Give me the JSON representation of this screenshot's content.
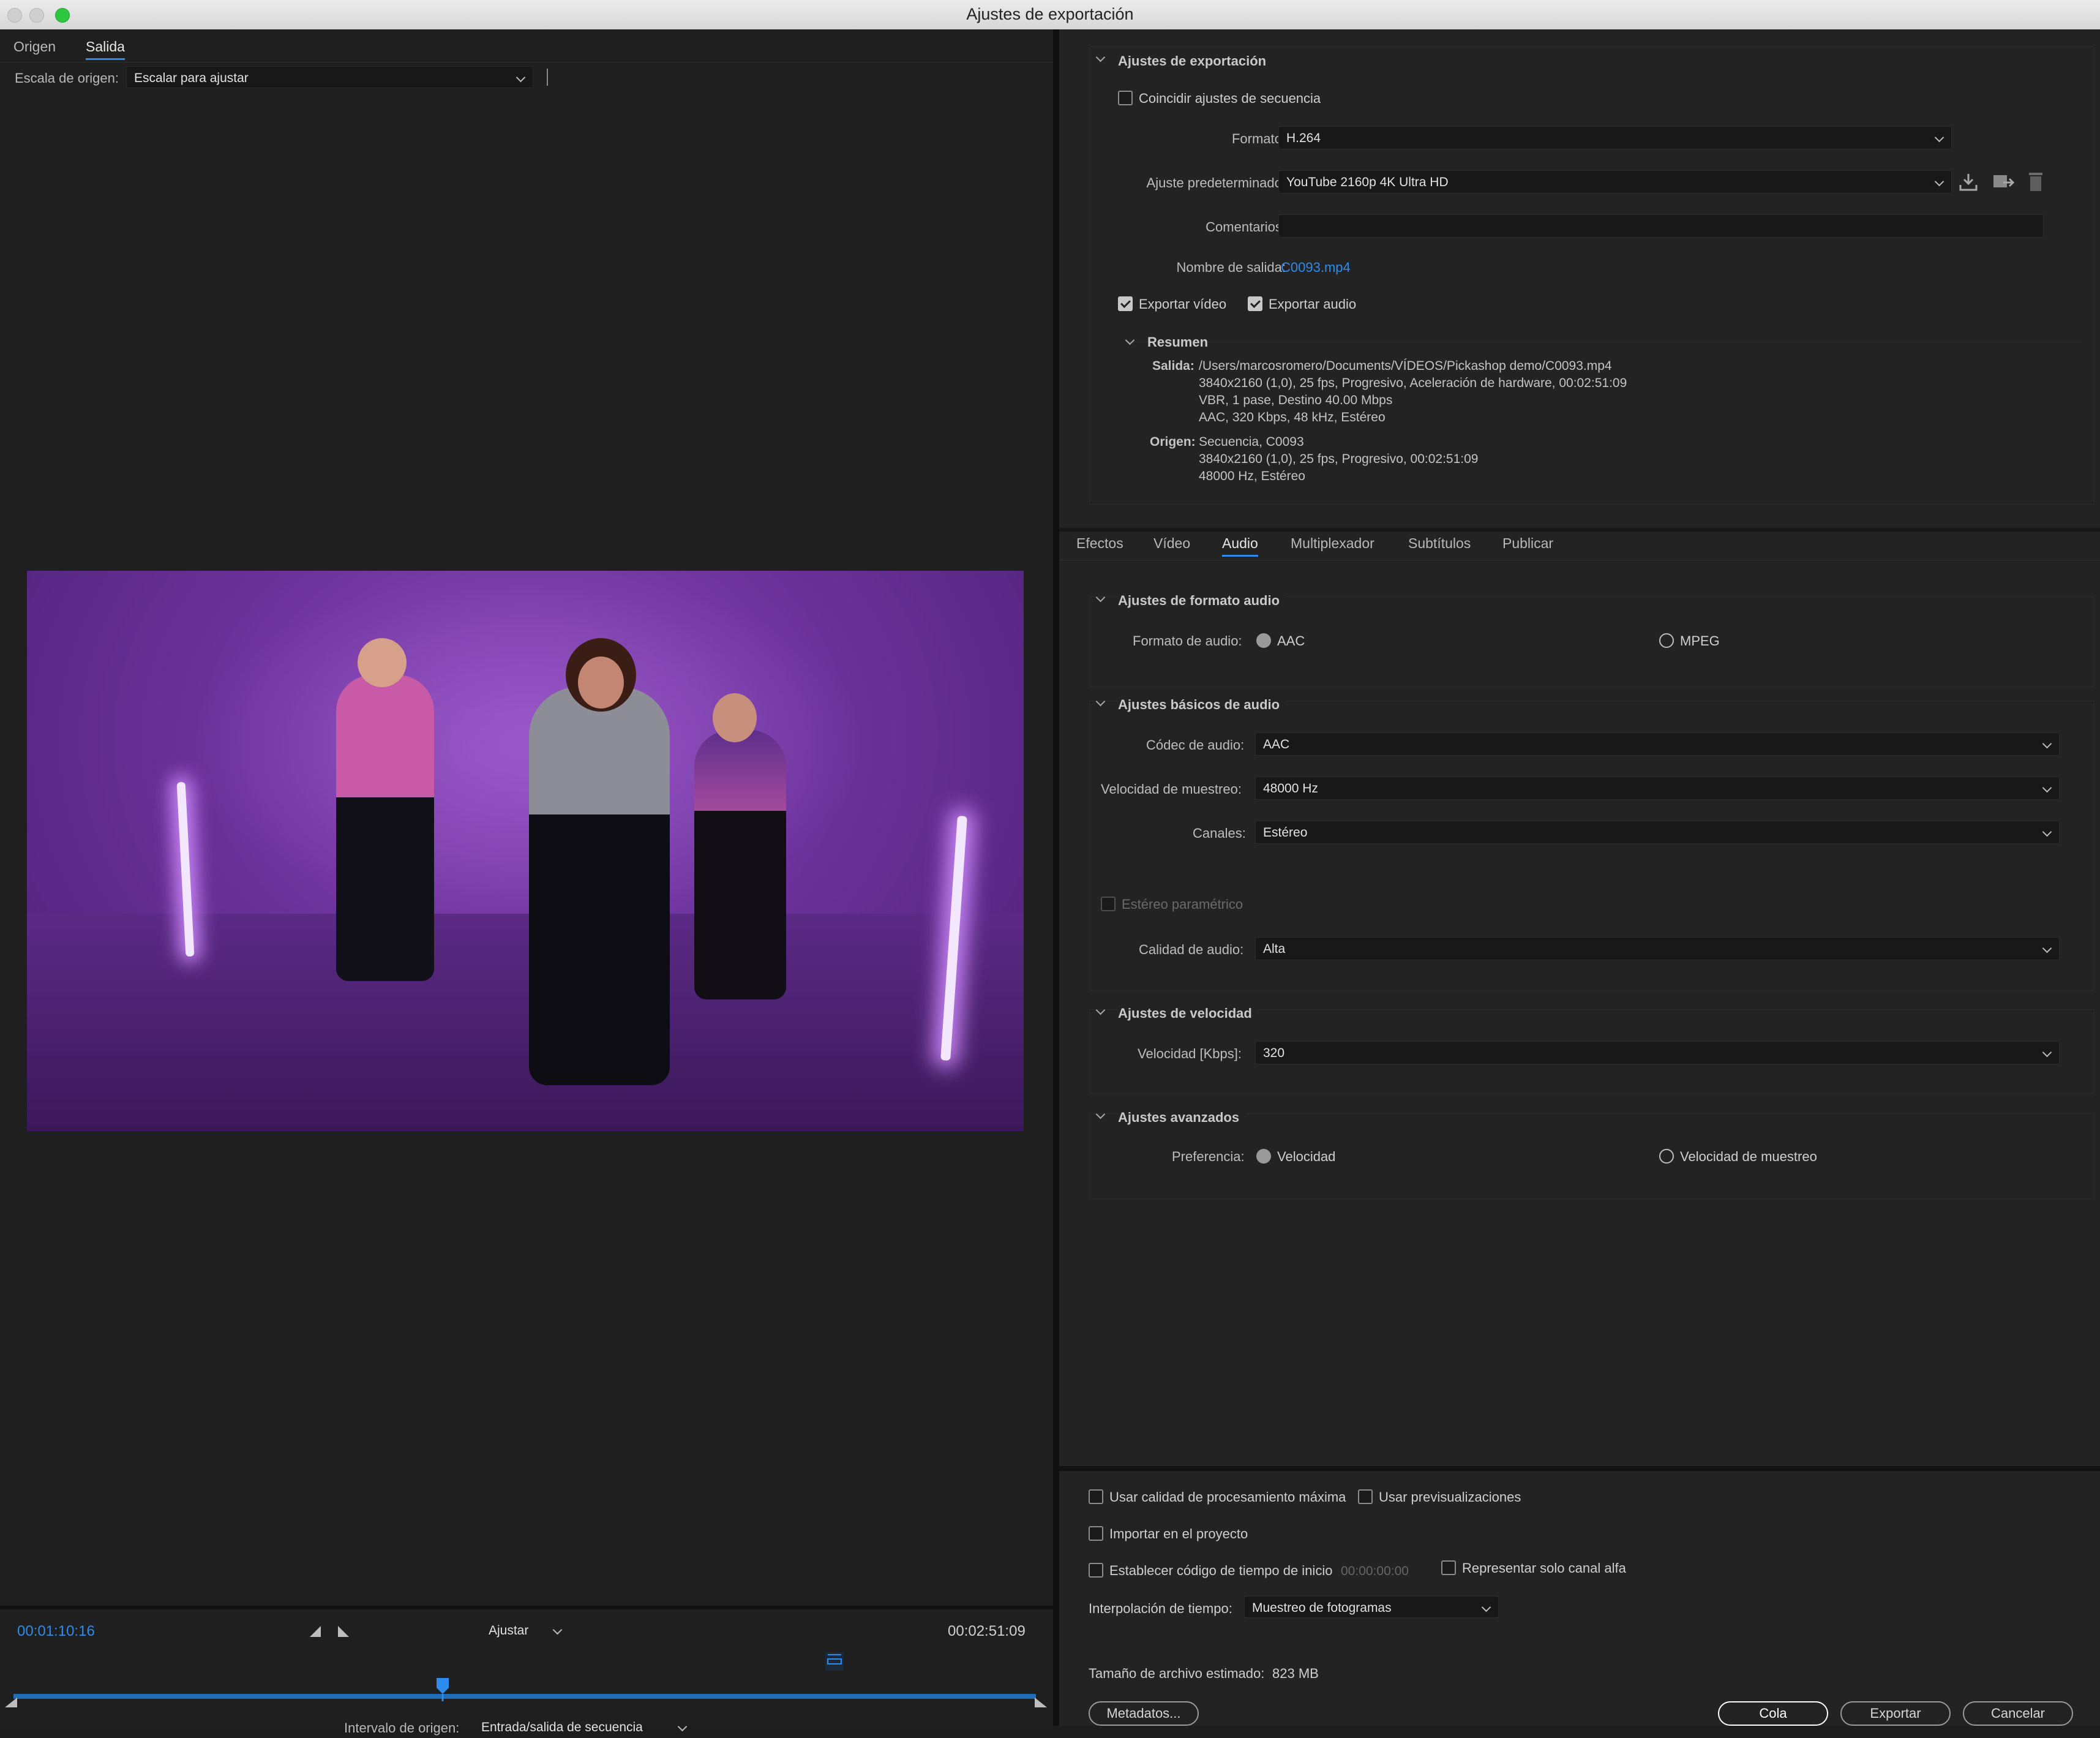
{
  "window": {
    "title": "Ajustes de exportación"
  },
  "left": {
    "tabs": [
      {
        "label": "Origen"
      },
      {
        "label": "Salida"
      }
    ],
    "source_scale": {
      "label": "Escala de origen:",
      "value": "Escalar para ajustar"
    },
    "timeline": {
      "current_time": "00:01:10:16",
      "zoom": "Ajustar",
      "duration": "00:02:51:09",
      "playhead_position": 0.42,
      "source_range_label": "Intervalo de origen:",
      "source_range_value": "Entrada/salida de secuencia"
    }
  },
  "export_settings": {
    "heading": "Ajustes de exportación",
    "match_sequence": "Coincidir ajustes de secuencia",
    "format_label": "Formato:",
    "format_value": "H.264",
    "preset_label": "Ajuste predeterminado:",
    "preset_value": "YouTube 2160p 4K Ultra HD",
    "comments_label": "Comentarios:",
    "output_name_label": "Nombre de salida:",
    "output_name_value": "C0093.mp4",
    "export_video": "Exportar vídeo",
    "export_audio": "Exportar audio",
    "summary": {
      "heading": "Resumen",
      "output_label": "Salida:",
      "output_lines": [
        "/Users/marcosromero/Documents/VÍDEOS/Pickashop demo/C0093.mp4",
        "3840x2160 (1,0), 25 fps, Progresivo,  Aceleración de hardware, 00:02:51:09",
        "VBR, 1 pase, Destino 40.00 Mbps",
        "AAC, 320 Kbps, 48 kHz, Estéreo"
      ],
      "source_label": "Origen:",
      "source_lines": [
        "Secuencia, C0093",
        "3840x2160 (1,0), 25 fps, Progresivo, 00:02:51:09",
        "48000 Hz, Estéreo"
      ]
    }
  },
  "tabs": [
    {
      "label": "Efectos"
    },
    {
      "label": "Vídeo"
    },
    {
      "label": "Audio"
    },
    {
      "label": "Multiplexador"
    },
    {
      "label": "Subtítulos"
    },
    {
      "label": "Publicar"
    }
  ],
  "audio": {
    "format_section": {
      "heading": "Ajustes de formato audio",
      "label": "Formato de audio:",
      "options": [
        "AAC",
        "MPEG"
      ]
    },
    "basic_section": {
      "heading": "Ajustes básicos de audio",
      "codec_label": "Códec de audio:",
      "codec_value": "AAC",
      "sample_rate_label": "Velocidad de muestreo:",
      "sample_rate_value": "48000 Hz",
      "channels_label": "Canales:",
      "channels_value": "Estéreo",
      "parametric_stereo": "Estéreo paramétrico",
      "quality_label": "Calidad de audio:",
      "quality_value": "Alta"
    },
    "bitrate_section": {
      "heading": "Ajustes de velocidad",
      "label": "Velocidad [Kbps]:",
      "value": "320"
    },
    "advanced_section": {
      "heading": "Ajustes avanzados",
      "label": "Preferencia:",
      "options": [
        "Velocidad",
        "Velocidad de muestreo"
      ]
    }
  },
  "bottom": {
    "max_quality": "Usar calidad de procesamiento máxima",
    "use_previews": "Usar previsualizaciones",
    "import_project": "Importar en el proyecto",
    "set_timecode": "Establecer código de tiempo de inicio",
    "timecode_value": "00:00:00:00",
    "alpha_only": "Representar solo canal alfa",
    "interp_label": "Interpolación de tiempo:",
    "interp_value": "Muestreo de fotogramas",
    "filesize_label": "Tamaño de archivo estimado:",
    "filesize_value": "823 MB",
    "metadata_btn": "Metadatos...",
    "queue_btn": "Cola",
    "export_btn": "Exportar",
    "cancel_btn": "Cancelar"
  },
  "colors": {
    "accent": "#2d8ceb",
    "link": "#2d8ceb",
    "background": "#1f1f1f"
  }
}
